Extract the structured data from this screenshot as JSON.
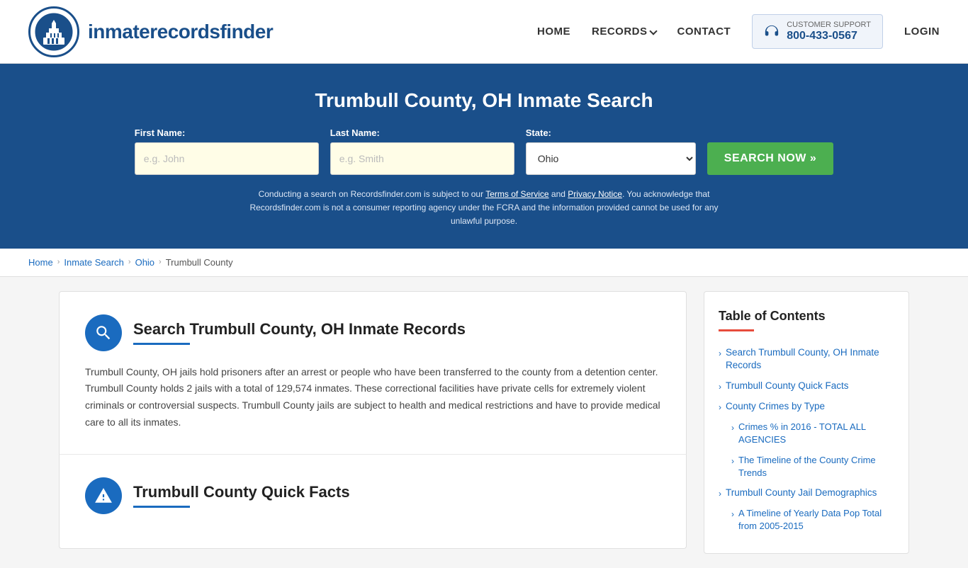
{
  "header": {
    "logo_text_normal": "inmaterecords",
    "logo_text_bold": "finder",
    "nav": {
      "home": "HOME",
      "records": "RECORDS",
      "contact": "CONTACT",
      "login": "LOGIN",
      "support_label": "CUSTOMER SUPPORT",
      "support_number": "800-433-0567"
    }
  },
  "hero": {
    "title": "Trumbull County, OH Inmate Search",
    "first_name_label": "First Name:",
    "first_name_placeholder": "e.g. John",
    "last_name_label": "Last Name:",
    "last_name_placeholder": "e.g. Smith",
    "state_label": "State:",
    "state_value": "Ohio",
    "search_button": "SEARCH NOW »",
    "disclaimer": "Conducting a search on Recordsfinder.com is subject to our Terms of Service and Privacy Notice. You acknowledge that Recordsfinder.com is not a consumer reporting agency under the FCRA and the information provided cannot be used for any unlawful purpose.",
    "disclaimer_tos": "Terms of Service",
    "disclaimer_privacy": "Privacy Notice"
  },
  "breadcrumb": {
    "home": "Home",
    "inmate_search": "Inmate Search",
    "ohio": "Ohio",
    "current": "Trumbull County"
  },
  "section1": {
    "title": "Search Trumbull County, OH Inmate Records",
    "body": "Trumbull County, OH jails hold prisoners after an arrest or people who have been transferred to the county from a detention center. Trumbull County holds 2 jails with a total of 129,574 inmates. These correctional facilities have private cells for extremely violent criminals or controversial suspects. Trumbull County jails are subject to health and medical restrictions and have to provide medical care to all its inmates."
  },
  "section2": {
    "title": "Trumbull County Quick Facts"
  },
  "toc": {
    "title": "Table of Contents",
    "items": [
      {
        "label": "Search Trumbull County, OH Inmate Records",
        "sub": false
      },
      {
        "label": "Trumbull County Quick Facts",
        "sub": false
      },
      {
        "label": "County Crimes by Type",
        "sub": false
      },
      {
        "label": "Crimes % in 2016 - TOTAL ALL AGENCIES",
        "sub": true
      },
      {
        "label": "The Timeline of the County Crime Trends",
        "sub": true
      },
      {
        "label": "Trumbull County Jail Demographics",
        "sub": false
      },
      {
        "label": "A Timeline of Yearly Data Pop Total from 2005-2015",
        "sub": true
      }
    ]
  }
}
